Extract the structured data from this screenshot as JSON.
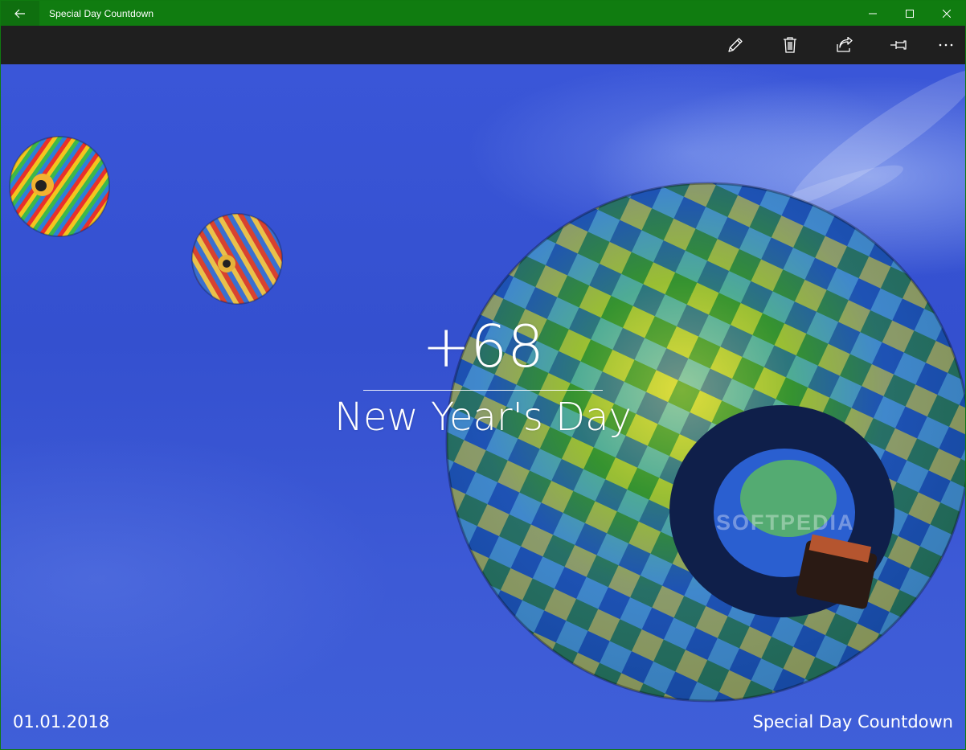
{
  "window": {
    "title": "Special Day Countdown",
    "caption_buttons": [
      "minimize",
      "maximize",
      "close"
    ]
  },
  "commandbar": {
    "items": [
      {
        "name": "edit",
        "icon": "pencil-icon"
      },
      {
        "name": "delete",
        "icon": "trash-icon"
      },
      {
        "name": "share",
        "icon": "share-icon"
      },
      {
        "name": "pin",
        "icon": "pin-icon"
      },
      {
        "name": "more",
        "icon": "more-icon"
      }
    ]
  },
  "countdown": {
    "value": "+68",
    "event": "New Year's Day",
    "date": "01.01.2018"
  },
  "footer": {
    "app_name": "Special Day Countdown"
  },
  "watermark": "SOFTPEDIA",
  "colors": {
    "titlebar": "#107c10",
    "commandbar": "#1f1f1f",
    "sky": "#3450cf",
    "text": "#ffffff"
  }
}
